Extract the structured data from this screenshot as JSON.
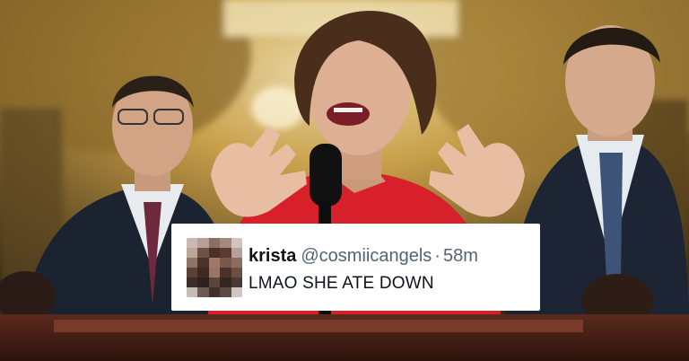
{
  "tweet": {
    "display_name": "krista",
    "handle": "@cosmiicangels",
    "separator": "·",
    "time_ago": "58m",
    "text": "LMAO SHE ATE DOWN"
  },
  "avatar": {
    "icon": "pixelated-avatar-icon"
  },
  "colors": {
    "card_background": "#ffffff",
    "name_text": "#0f1419",
    "meta_text": "#536471",
    "jacket_red": "#d8202a",
    "suit_navy": "#1d2433",
    "background_gold": "#c9a04a"
  }
}
